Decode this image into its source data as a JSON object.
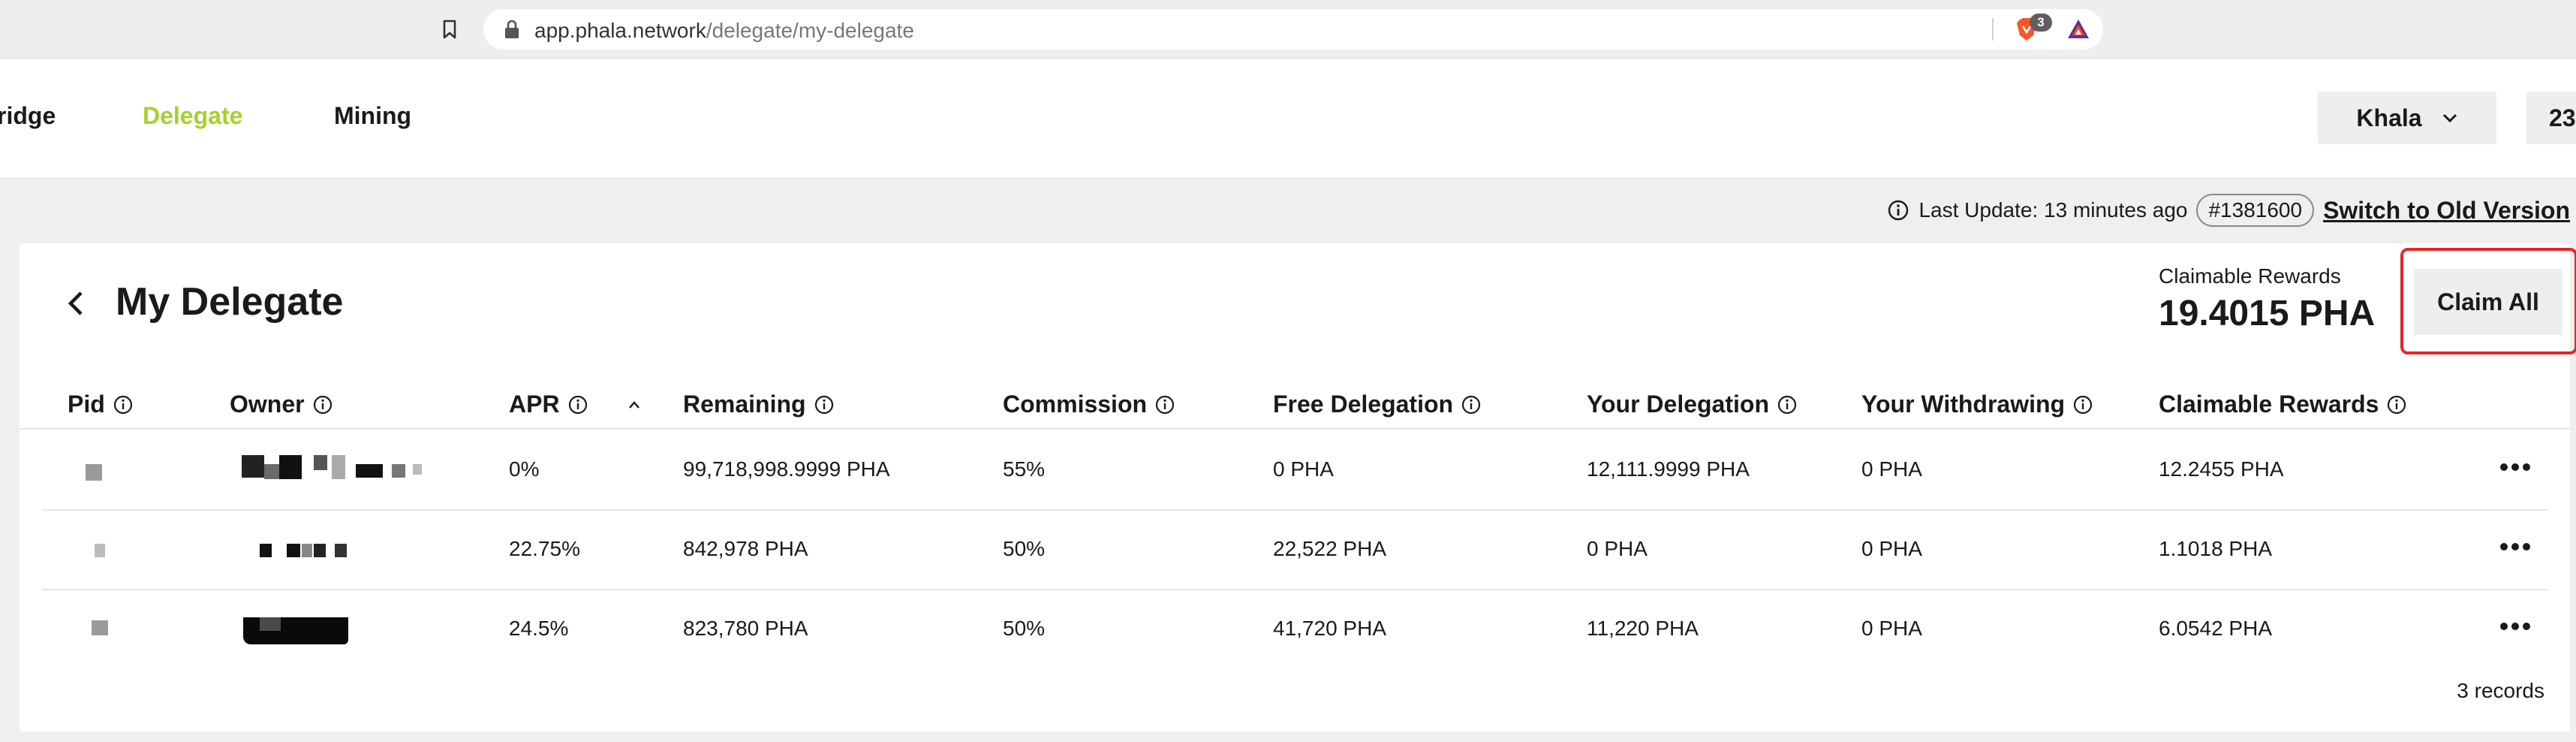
{
  "browser": {
    "url_host": "app.phala.network",
    "url_path": "/delegate/my-delegate",
    "extension_badge": "3"
  },
  "nav": {
    "items": [
      "ridge",
      "Delegate",
      "Mining"
    ],
    "active": "Delegate",
    "network": "Khala",
    "account_stub": "23"
  },
  "info_bar": {
    "last_update": "Last Update: 13 minutes ago",
    "block": "#1381600",
    "switch_label": "Switch to Old Version"
  },
  "page": {
    "title": "My Delegate",
    "claimable_caption": "Claimable Rewards",
    "claimable_total": "19.4015 PHA",
    "claim_all_label": "Claim All"
  },
  "table": {
    "columns": [
      "Pid",
      "Owner",
      "APR",
      "Remaining",
      "Commission",
      "Free Delegation",
      "Your Delegation",
      "Your Withdrawing",
      "Claimable Rewards"
    ],
    "rows": [
      {
        "apr": "0%",
        "remaining": "99,718,998.9999 PHA",
        "commission": "55%",
        "free_delegation": "0 PHA",
        "your_delegation": "12,111.9999 PHA",
        "your_withdrawing": "0 PHA",
        "claimable_rewards": "12.2455 PHA"
      },
      {
        "apr": "22.75%",
        "remaining": "842,978 PHA",
        "commission": "50%",
        "free_delegation": "22,522 PHA",
        "your_delegation": "0 PHA",
        "your_withdrawing": "0 PHA",
        "claimable_rewards": "1.1018 PHA"
      },
      {
        "apr": "24.5%",
        "remaining": "823,780 PHA",
        "commission": "50%",
        "free_delegation": "41,720 PHA",
        "your_delegation": "11,220 PHA",
        "your_withdrawing": "0 PHA",
        "claimable_rewards": "6.0542 PHA"
      }
    ],
    "records": "3 records"
  },
  "colors": {
    "accent": "#a5d22c",
    "highlight_border": "#e0292c",
    "button_bg": "#eeeeee",
    "page_bg": "#efefef"
  }
}
